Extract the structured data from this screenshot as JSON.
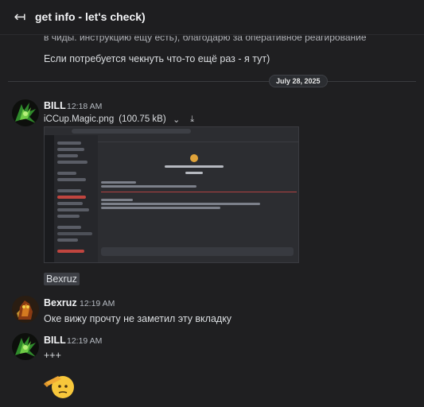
{
  "header": {
    "title": "get info - let's check)",
    "back_icon": "back-arrow-icon"
  },
  "history": {
    "truncated_line": "в чиды. инструкцию ещу есть), благодарю за оперативное реагирование",
    "last_line": "Если потребуется чекнуть что-то ещё раз - я тут)"
  },
  "date_divider": "July 28, 2025",
  "messages": [
    {
      "author": "BILL",
      "time": "12:18 AM",
      "attachment": {
        "filename": "iCCup.Magic.png",
        "size": "(100.75 kB)"
      },
      "mention": "Bexruz"
    },
    {
      "author": "Bexruz",
      "time": "12:19 AM",
      "text": "Оке вижу прочту не заметил эту вкладку"
    },
    {
      "author": "BILL",
      "time": "12:19 AM",
      "text": "+++",
      "emoji": "saluting-face"
    }
  ],
  "colors": {
    "background": "#1f1f21",
    "name": "#f2f3f5",
    "timestamp": "#b5bac1",
    "mention_bg": "#3d3f45"
  }
}
